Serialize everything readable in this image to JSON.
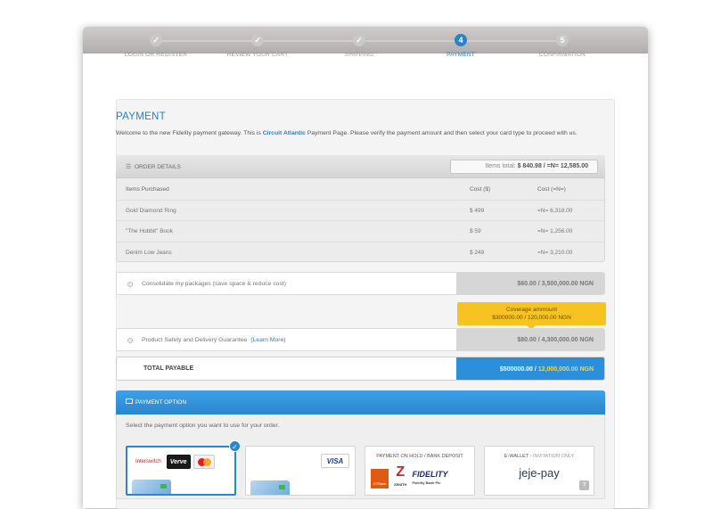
{
  "stepper": {
    "steps": [
      {
        "label": "LOGIN OR REGISTER",
        "mark": "✓"
      },
      {
        "label": "REVIEW YOUR CART",
        "mark": "✓"
      },
      {
        "label": "SHIPPING",
        "mark": "✓"
      },
      {
        "label": "PAYMENT",
        "mark": "4"
      },
      {
        "label": "CONFIRMATION",
        "mark": "5"
      }
    ]
  },
  "payment": {
    "title": "PAYMENT",
    "welcome_pre": "Welcome to the new Fidelity payment gateway. This is ",
    "merchant": "Circuit Atlantic",
    "welcome_post": " Payment Page. Please verify the payment amount and then select your card type to proceed with us."
  },
  "order": {
    "title": "ORDER DETAILS",
    "items_total_label": "Items total: ",
    "items_total_value": "$ 840.98 / =N= 12,585.00",
    "headers": [
      "Items Purchased",
      "Cost ($)",
      "Cost (=N=)"
    ],
    "rows": [
      [
        "Gold Diamond Ring",
        "$ 499",
        "=N= 6,318.00"
      ],
      [
        "\"The Hobbit\" Book",
        "$ 59",
        "=N= 1,256.00"
      ],
      [
        "Denim Low Jeans",
        "$ 249",
        "=N= 3,210.00"
      ]
    ]
  },
  "options": {
    "consolidate": {
      "label": "Consolidate my packages (save space & reduce cost)",
      "price": "$60.00 / 3,500,000.00 NGN"
    },
    "coverage": {
      "title": "Coverage ammount",
      "value": "$300000.00 / 120,000.00 NGN"
    },
    "safety": {
      "label": "Product Safety and Delivery Guarantee",
      "link": "(Learn More)",
      "price": "$80.00 / 4,300,000.00 NGN"
    }
  },
  "total": {
    "label": "TOTAL PAYABLE",
    "usd": "$500000.00 / ",
    "ngn": "12,000,000.00 NGN"
  },
  "payment_option": {
    "title": "PAYMENT OPTION",
    "description": "Select the payment option you want to use for your order.",
    "cards": {
      "interswitch": "Interswitch",
      "verve": "Verve",
      "visa": "VISA"
    },
    "bank": {
      "title": "PAYMENT ON HOLD / BANK DEPOSIT",
      "gt": "GTBank",
      "zenith": "ZENITH",
      "fidelity": "FIDELITY",
      "fidelity_sub": "Fidelity Bank Plc"
    },
    "ewallet": {
      "title": "E-WALLET - ",
      "title_note": "INVITATION ONLY",
      "logo": "jeje-pay",
      "help": "?"
    }
  },
  "colors": {
    "accent": "#2b83c6",
    "tooltip": "#f7c320",
    "total_bar": "#2c8fd9",
    "ngn_highlight": "#ffd43a"
  }
}
